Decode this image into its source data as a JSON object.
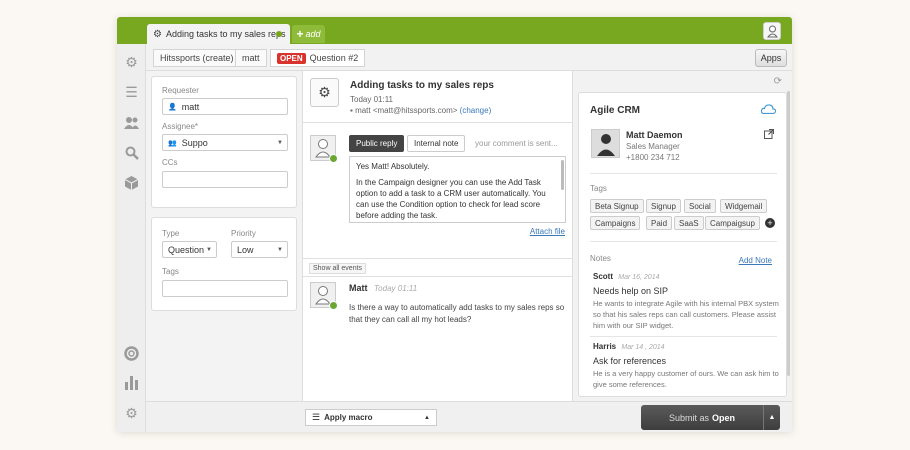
{
  "tabs": {
    "active_label": "Adding tasks to my sales reps",
    "add_label": "add"
  },
  "breadcrumb": {
    "org": "Hitssports (create)",
    "user": "matt",
    "status": "OPEN",
    "ticket": "Question #2"
  },
  "apps_label": "Apps",
  "ticket_fields": {
    "requester_label": "Requester",
    "requester_value": "matt",
    "assignee_label": "Assignee*",
    "assignee_value": "Suppo",
    "ccs_label": "CCs",
    "type_label": "Type",
    "type_value": "Question",
    "priority_label": "Priority",
    "priority_value": "Low",
    "tags_label": "Tags"
  },
  "ticket": {
    "subject": "Adding tasks to my sales reps",
    "time": "Today 01:11",
    "email_line": "matt <matt@hitssports.com>",
    "change_label": "(change)"
  },
  "reply": {
    "public_tab": "Public reply",
    "internal_tab": "Internal note",
    "placeholder": "your comment is sent...",
    "para1": "Yes Matt! Absolutely.",
    "para2": "In the Campaign designer you can use the Add Task option to add a task to a CRM user automatically. You can use the Condition option to check for lead score before adding the task.",
    "attach_label": "Attach file"
  },
  "events": {
    "show_all": "Show all events",
    "author": "Matt",
    "time": "Today 01:11",
    "message": "Is there a way to automatically add tasks to my sales reps so that they can call all my hot leads?"
  },
  "crm": {
    "title": "Agile CRM",
    "contact": {
      "name": "Matt Daemon",
      "title": "Sales Manager",
      "phone": "+1800 234 712"
    },
    "tags_label": "Tags",
    "tags": [
      "Beta Signup",
      "Signup",
      "Social",
      "Widgemail",
      "Campaigns",
      "Paid",
      "SaaS",
      "Campaigsup"
    ],
    "notes_label": "Notes",
    "add_note": "Add Note",
    "notes": [
      {
        "author": "Scott",
        "date": "Mar 16, 2014",
        "subject": "Needs help on SIP",
        "body": "He wants to integrate Agile with his internal PBX system so that his sales reps can call customers. Please assist him with our SIP widget."
      },
      {
        "author": "Harris",
        "date": "Mar 14 , 2014",
        "subject": "Ask for references",
        "body": "He is a very happy customer of ours. We can ask him to give some references."
      }
    ]
  },
  "footer": {
    "macro_label": "Apply macro",
    "submit_prefix": "Submit as",
    "submit_status": "Open"
  },
  "colors": {
    "brand_green": "#77a81f",
    "open_badge": "#d9332d",
    "link": "#3a78b8"
  }
}
